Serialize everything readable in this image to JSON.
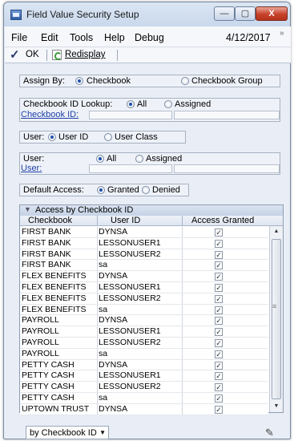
{
  "window": {
    "title": "Field Value Security Setup"
  },
  "window_controls": {
    "minimize": "—",
    "maximize": "▢",
    "close": "X"
  },
  "menu": {
    "items": [
      "File",
      "Edit",
      "Tools",
      "Help",
      "Debug"
    ],
    "date": "4/12/2017",
    "overflow": "»"
  },
  "toolbar": {
    "ok_label": "OK",
    "redisplay_label": "Redisplay"
  },
  "assign_by": {
    "label": "Assign By:",
    "options": [
      "Checkbook",
      "Checkbook Group"
    ],
    "selected": "Checkbook"
  },
  "checkbook_lookup": {
    "label": "Checkbook ID Lookup:",
    "options": [
      "All",
      "Assigned"
    ],
    "selected": "All",
    "field_label": "Checkbook ID:"
  },
  "user_type": {
    "label": "User:",
    "options": [
      "User ID",
      "User Class"
    ],
    "selected": "User ID"
  },
  "user_lookup": {
    "label": "User:",
    "options": [
      "All",
      "Assigned"
    ],
    "selected": "All",
    "field_label": "User:"
  },
  "default_access": {
    "label": "Default Access:",
    "options": [
      "Granted",
      "Denied"
    ],
    "selected": "Granted"
  },
  "grid": {
    "title": "Access by Checkbook ID",
    "columns": [
      "Checkbook",
      "User ID",
      "Access Granted"
    ],
    "rows": [
      {
        "checkbook": "FIRST BANK",
        "user": "DYNSA",
        "granted": true
      },
      {
        "checkbook": "FIRST BANK",
        "user": "LESSONUSER1",
        "granted": true
      },
      {
        "checkbook": "FIRST BANK",
        "user": "LESSONUSER2",
        "granted": true
      },
      {
        "checkbook": "FIRST BANK",
        "user": "sa",
        "granted": true
      },
      {
        "checkbook": "FLEX BENEFITS",
        "user": "DYNSA",
        "granted": true
      },
      {
        "checkbook": "FLEX BENEFITS",
        "user": "LESSONUSER1",
        "granted": true
      },
      {
        "checkbook": "FLEX BENEFITS",
        "user": "LESSONUSER2",
        "granted": true
      },
      {
        "checkbook": "FLEX BENEFITS",
        "user": "sa",
        "granted": true
      },
      {
        "checkbook": "PAYROLL",
        "user": "DYNSA",
        "granted": true
      },
      {
        "checkbook": "PAYROLL",
        "user": "LESSONUSER1",
        "granted": true
      },
      {
        "checkbook": "PAYROLL",
        "user": "LESSONUSER2",
        "granted": true
      },
      {
        "checkbook": "PAYROLL",
        "user": "sa",
        "granted": true
      },
      {
        "checkbook": "PETTY CASH",
        "user": "DYNSA",
        "granted": true
      },
      {
        "checkbook": "PETTY CASH",
        "user": "LESSONUSER1",
        "granted": true
      },
      {
        "checkbook": "PETTY CASH",
        "user": "LESSONUSER2",
        "granted": true
      },
      {
        "checkbook": "PETTY CASH",
        "user": "sa",
        "granted": true
      },
      {
        "checkbook": "UPTOWN TRUST",
        "user": "DYNSA",
        "granted": true
      }
    ]
  },
  "footer": {
    "sort_value": "by Checkbook ID"
  },
  "icons": {
    "app": "window-app-icon",
    "ok": "checkmark-icon",
    "redisplay": "refresh-icon",
    "note": "note-icon"
  },
  "colors": {
    "link": "#1c3fa8",
    "accent": "#1f4fae",
    "close": "#c7412a"
  }
}
